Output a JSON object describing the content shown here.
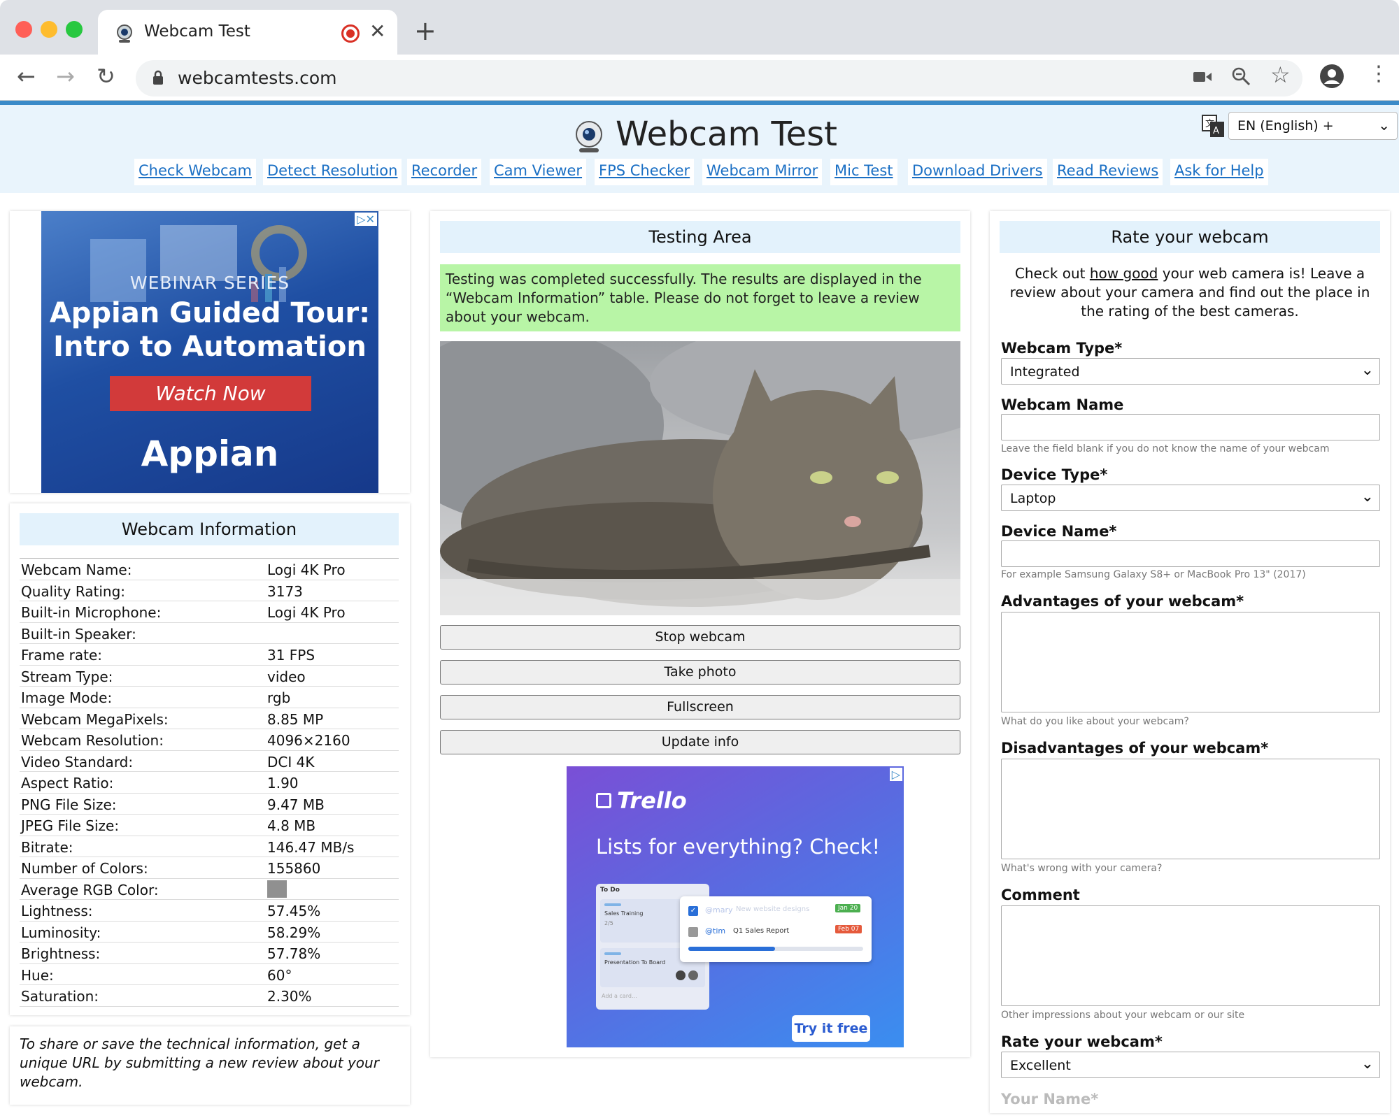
{
  "browser": {
    "tab_title": "Webcam Test",
    "url": "webcamtests.com"
  },
  "header": {
    "title": "Webcam Test",
    "language": "EN (English) +",
    "nav": [
      "Check Webcam",
      "Detect Resolution",
      "Recorder",
      "Cam Viewer",
      "FPS Checker",
      "Webcam Mirror",
      "Mic Test",
      "Download Drivers",
      "Read Reviews",
      "Ask for Help"
    ]
  },
  "ad_top": {
    "series": "WEBINAR SERIES",
    "headline_1": "Appian Guided Tour:",
    "headline_2": "Intro to Automation",
    "cta": "Watch Now",
    "logo": "Appian"
  },
  "info": {
    "title": "Webcam Information",
    "rows": [
      {
        "k": "Webcam Name:",
        "v": "Logi 4K Pro"
      },
      {
        "k": "Quality Rating:",
        "v": "3173"
      },
      {
        "k": "Built-in Microphone:",
        "v": "Logi 4K Pro"
      },
      {
        "k": "Built-in Speaker:",
        "v": ""
      },
      {
        "k": "Frame rate:",
        "v": "31 FPS"
      },
      {
        "k": "Stream Type:",
        "v": "video"
      },
      {
        "k": "Image Mode:",
        "v": "rgb"
      },
      {
        "k": "Webcam MegaPixels:",
        "v": "8.85 MP"
      },
      {
        "k": "Webcam Resolution:",
        "v": "4096×2160"
      },
      {
        "k": "Video Standard:",
        "v": "DCI 4K"
      },
      {
        "k": "Aspect Ratio:",
        "v": "1.90"
      },
      {
        "k": "PNG File Size:",
        "v": "9.47 MB"
      },
      {
        "k": "JPEG File Size:",
        "v": "4.8 MB"
      },
      {
        "k": "Bitrate:",
        "v": "146.47 MB/s"
      },
      {
        "k": "Number of Colors:",
        "v": "155860"
      },
      {
        "k": "Average RGB Color:",
        "v": ""
      },
      {
        "k": "Lightness:",
        "v": "57.45%"
      },
      {
        "k": "Luminosity:",
        "v": "58.29%"
      },
      {
        "k": "Brightness:",
        "v": "57.78%"
      },
      {
        "k": "Hue:",
        "v": "60°"
      },
      {
        "k": "Saturation:",
        "v": "2.30%"
      }
    ],
    "avg_color": "#909090",
    "share_note": "To share or save the technical information, get a unique URL by submitting a new review about your webcam."
  },
  "testing": {
    "title": "Testing Area",
    "success": "Testing was completed successfully. The results are displayed in the “Webcam Information” table. Please do not forget to leave a review about your webcam.",
    "buttons": [
      "Stop webcam",
      "Take photo",
      "Fullscreen",
      "Update info"
    ]
  },
  "ad_trello": {
    "logo": "Trello",
    "headline": "Lists for everything? Check!",
    "card_list_title": "To Do",
    "card_1": "Sales Training",
    "card_1_meta": "2/5",
    "card_2": "Presentation To Board",
    "add_card": "Add a card...",
    "item_1_user": "@mary",
    "item_1_text": "New website designs",
    "item_1_date": "Jan 20",
    "item_2_user": "@tim",
    "item_2_text": "Q1 Sales Report",
    "item_2_date": "Feb 07",
    "cta": "Try it free"
  },
  "rate": {
    "title": "Rate your webcam",
    "intro_before": "Check out ",
    "intro_link": "how good",
    "intro_after": " your web camera is! Leave a review about your camera and find out the place in the rating of the best cameras.",
    "webcam_type_label": "Webcam Type*",
    "webcam_type_value": "Integrated",
    "webcam_name_label": "Webcam Name",
    "webcam_name_hint": "Leave the field blank if you do not know the name of your webcam",
    "device_type_label": "Device Type*",
    "device_type_value": "Laptop",
    "device_name_label": "Device Name*",
    "device_name_hint": "For example Samsung Galaxy S8+ or MacBook Pro 13\" (2017)",
    "advantages_label": "Advantages of your webcam*",
    "advantages_hint": "What do you like about your webcam?",
    "disadvantages_label": "Disadvantages of your webcam*",
    "disadvantages_hint": "What's wrong with your camera?",
    "comment_label": "Comment",
    "comment_hint": "Other impressions about your webcam or our site",
    "rating_label": "Rate your webcam*",
    "rating_value": "Excellent",
    "your_name_label": "Your Name*"
  }
}
